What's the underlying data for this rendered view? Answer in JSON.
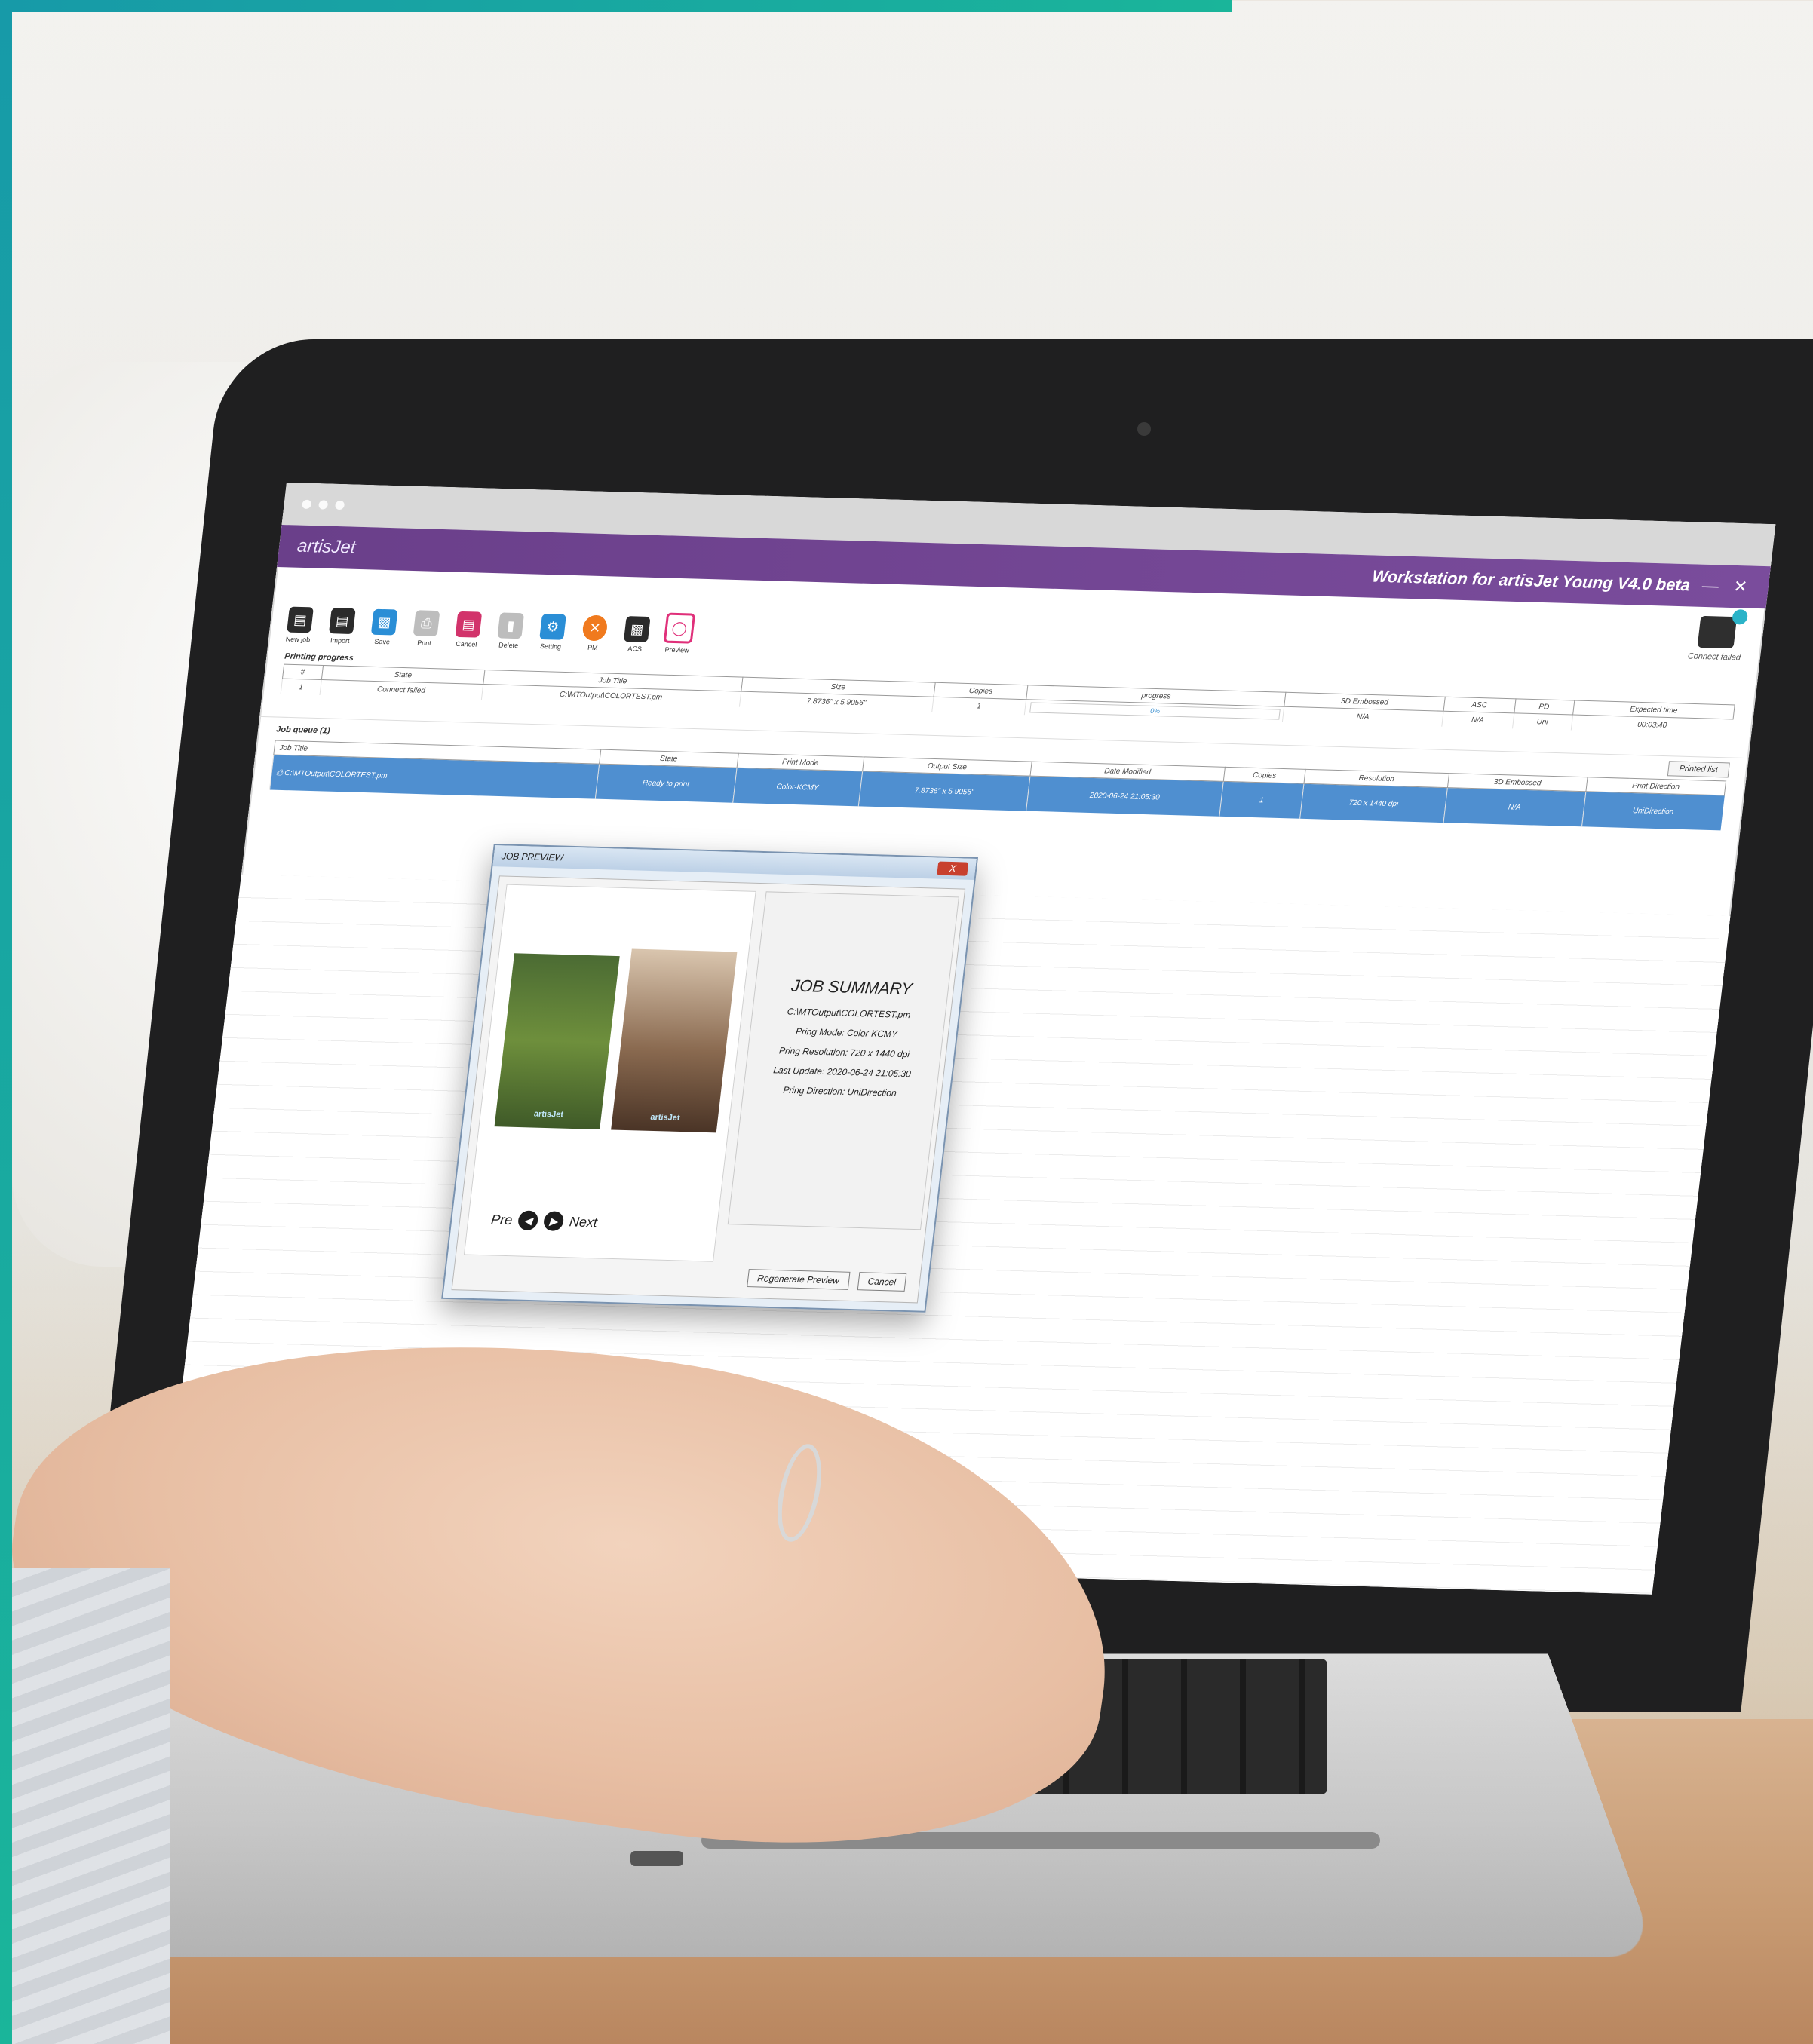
{
  "app": {
    "brand": "artisJet",
    "title": "Workstation for artisJet Young V4.0 beta"
  },
  "toolbar": {
    "items": [
      {
        "label": "New job",
        "icon": "new-job-icon"
      },
      {
        "label": "Import",
        "icon": "import-icon"
      },
      {
        "label": "Save",
        "icon": "save-icon"
      },
      {
        "label": "Print",
        "icon": "print-icon"
      },
      {
        "label": "Cancel",
        "icon": "cancel-icon"
      },
      {
        "label": "Delete",
        "icon": "delete-icon"
      },
      {
        "label": "Setting",
        "icon": "setting-icon"
      },
      {
        "label": "PM",
        "icon": "pm-icon"
      },
      {
        "label": "ACS",
        "icon": "acs-icon"
      },
      {
        "label": "Preview",
        "icon": "preview-icon"
      }
    ],
    "connect_label": "Connect failed"
  },
  "printing_progress": {
    "label": "Printing progress",
    "columns": [
      "#",
      "State",
      "Job Title",
      "Size",
      "Copies",
      "progress",
      "3D Embossed",
      "ASC",
      "PD",
      "Expected time"
    ],
    "row": {
      "index": "1",
      "state": "Connect failed",
      "job_title": "C:\\MTOutput\\COLORTEST.pm",
      "size": "7.8736\" x 5.9056\"",
      "copies": "1",
      "progress_percent": 0,
      "progress_text": "0%",
      "embossed": "N/A",
      "asc": "N/A",
      "pd": "Uni",
      "expected_time": "00:03:40"
    }
  },
  "job_queue": {
    "label": "Job queue (1)",
    "printed_list_label": "Printed list",
    "columns": [
      "Job Title",
      "State",
      "Print Mode",
      "Output Size",
      "Date Modified",
      "Copies",
      "Resolution",
      "3D Embossed",
      "Print Direction"
    ],
    "row": {
      "job_title": "C:\\MTOutput\\COLORTEST.pm",
      "state": "Ready to print",
      "print_mode": "Color-KCMY",
      "output_size": "7.8736\" x 5.9056\"",
      "date_modified": "2020-06-24 21:05:30",
      "copies": "1",
      "resolution": "720 x 1440 dpi",
      "embossed": "N/A",
      "print_direction": "UniDirection"
    }
  },
  "job_preview": {
    "title": "JOB PREVIEW",
    "close_label": "X",
    "nav": {
      "prev_label": "Pre",
      "next_label": "Next"
    },
    "photo_logo": "artisJet",
    "summary": {
      "heading": "JOB SUMMARY",
      "file": "C:\\MTOutput\\COLORTEST.pm",
      "mode": "Pring Mode: Color-KCMY",
      "resolution": "Pring Resolution: 720 x 1440 dpi",
      "last_update": "Last Update: 2020-06-24 21:05:30",
      "direction": "Pring Direction: UniDirection"
    },
    "regenerate_label": "Regenerate Preview",
    "cancel_label": "Cancel"
  },
  "colors": {
    "titlebar": "#6a3f8a",
    "selection": "#4f8fd0",
    "accent": "#179aa8"
  }
}
